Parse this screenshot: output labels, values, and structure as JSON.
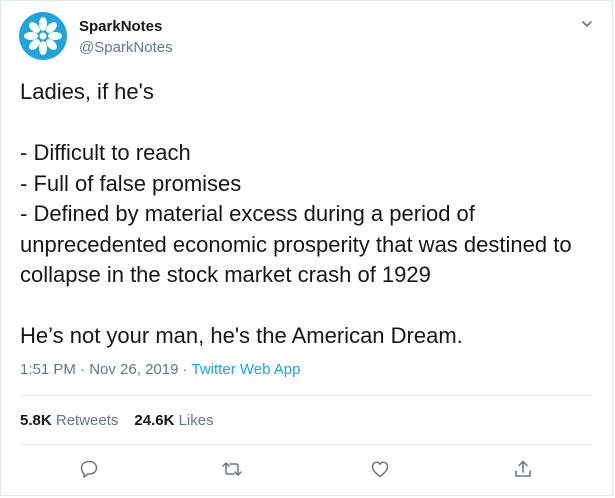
{
  "author": {
    "name": "SparkNotes",
    "handle": "@SparkNotes"
  },
  "tweet_text": "Ladies, if he's\n\n- Difficult to reach\n- Full of false promises\n- Defined by material excess during a period of unprecedented economic prosperity that was destined to collapse in the stock market crash of 1929\n\nHe’s not your man, he's the American Dream.",
  "meta": {
    "time": "1:51 PM",
    "sep1": " · ",
    "date": "Nov 26, 2019",
    "sep2": " · ",
    "app": "Twitter Web App"
  },
  "stats": {
    "retweets_count": "5.8K",
    "retweets_label": " Retweets",
    "likes_count": "24.6K",
    "likes_label": " Likes"
  },
  "icons": {
    "avatar": "sparknotes-logo",
    "menu": "chevron-down-icon",
    "reply": "reply-icon",
    "retweet": "retweet-icon",
    "like": "heart-icon",
    "share": "share-icon"
  },
  "colors": {
    "accent": "#1da1f2",
    "secondary_text": "#657786",
    "brand": "#1fa4de"
  }
}
